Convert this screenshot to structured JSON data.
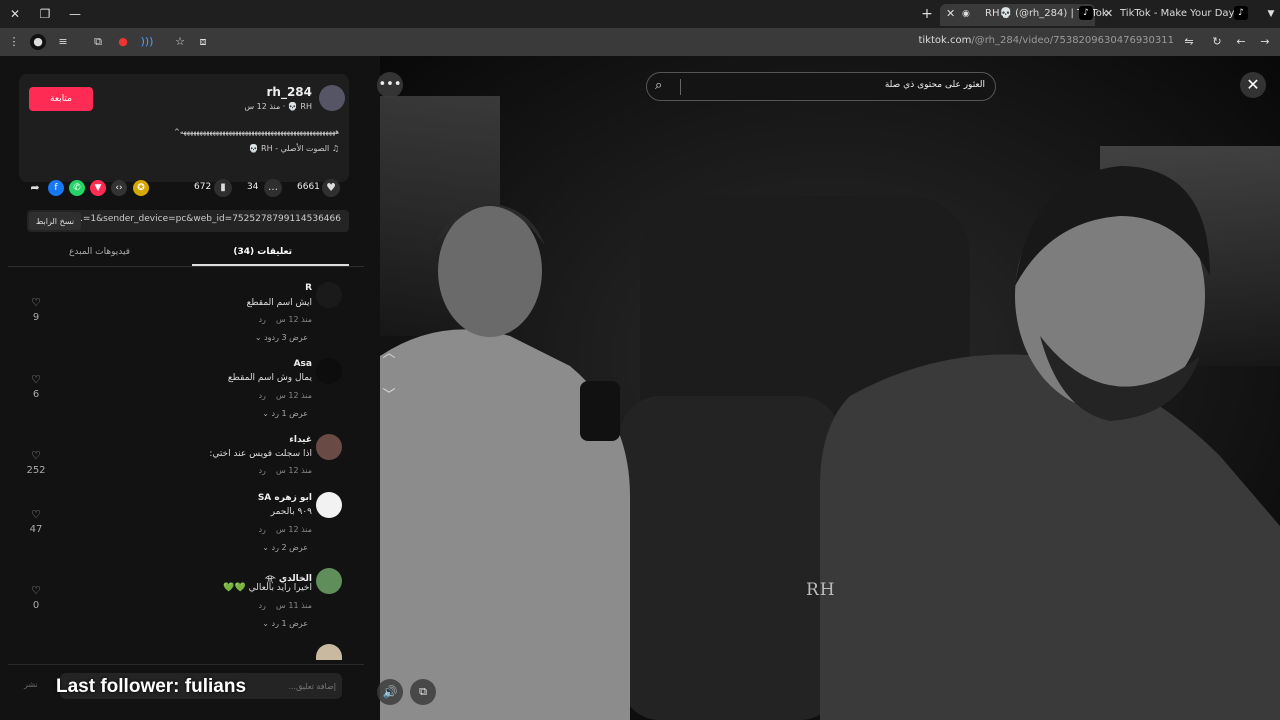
{
  "browser": {
    "tabs": [
      {
        "title": "RH💀 (@rh_284) | TikTok",
        "active": true
      },
      {
        "title": "TikTok - Make Your Day",
        "active": false
      }
    ],
    "url_host": "tiktok.com",
    "url_path": "/@rh_284/video/7538209630476930311"
  },
  "post": {
    "username": "rh_284",
    "nickname": "RH 💀",
    "time_ago": "منذ 12 س",
    "follow_label": "متابعة",
    "caption": "ههههههههههههههههههههههههههههههههههههههههههههههههه^",
    "music": "الصوت الأصلي - RH 💀"
  },
  "stats": {
    "likes": "6661",
    "comments": "34",
    "saves": "672"
  },
  "link": {
    "text": "...=1&sender_device=pc&web_id=7525278799114536466",
    "copy_label": "نسخ الرابط"
  },
  "panel_tabs": {
    "comments": "تعليقات (34)",
    "creator_videos": "فيديوهات المبدع"
  },
  "comments": [
    {
      "name": "R",
      "text": "ايش اسم المقطع",
      "time": "منذ 12 س",
      "reply": "رد",
      "likes": "9",
      "more": "عرض 3 ردود"
    },
    {
      "name": "Asa",
      "text": "يمال وش اسم المقطع",
      "time": "منذ 12 س",
      "reply": "رد",
      "likes": "6",
      "more": "عرض 1 رد"
    },
    {
      "name": "غيداء",
      "text": "اذا سجلت فويس عند اختي:",
      "time": "منذ 12 س",
      "reply": "رد",
      "likes": "252",
      "more": ""
    },
    {
      "name": "ابو زهره SA",
      "text": "٩٠٩ بالحمر",
      "time": "منذ 12 س",
      "reply": "رد",
      "likes": "47",
      "more": "عرض 2 رد"
    },
    {
      "name": "الخالدي 𓁿",
      "text": "اخيرا رايد بالعالي 💚💚",
      "time": "منذ 11 س",
      "reply": "رد",
      "likes": "0",
      "more": "عرض 1 رد"
    }
  ],
  "comment_input": {
    "placeholder": "إضافة تعليق...",
    "post_label": "نشر"
  },
  "stream_overlay": "Last follower: fulians",
  "video": {
    "search_placeholder": "العثور على محتوى ذي صلة",
    "watermark": "RH"
  },
  "colors": {
    "follow": "#fe2c55",
    "panel_bg": "#121212"
  }
}
